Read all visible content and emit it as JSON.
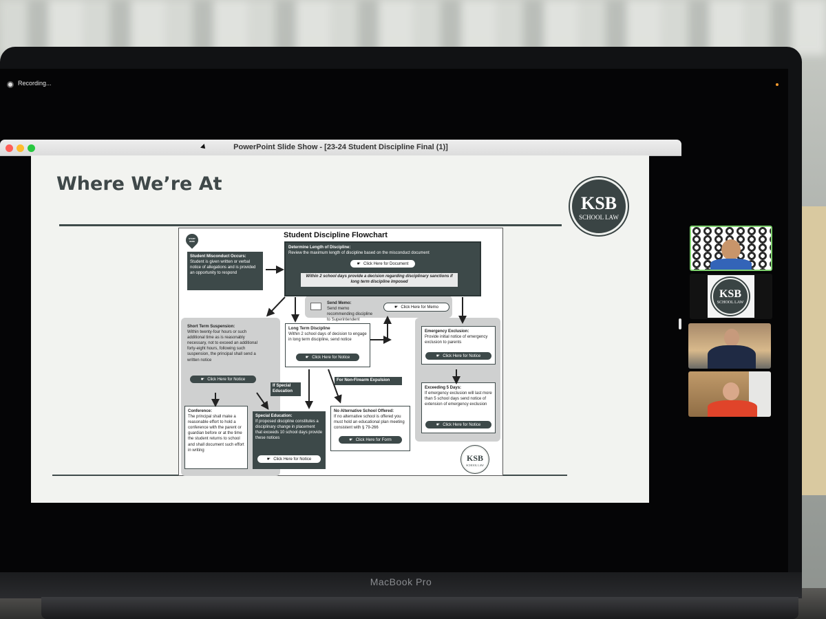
{
  "recording": {
    "label": "Recording..."
  },
  "window": {
    "title": "PowerPoint Slide Show - [23-24 Student Discipline Final (1)]"
  },
  "slide": {
    "title": "Where We’re At",
    "logo": {
      "main": "KSB",
      "sub": "SCHOOL LAW"
    }
  },
  "flowchart": {
    "title": "Student Discipline Flowchart",
    "start_label": "START HERE",
    "misconduct": {
      "head": "Student Misconduct Occurs:",
      "body": "Student is given written or verbal notice of allegations and is provided an opportunity to respond"
    },
    "length": {
      "head": "Determine Length of Discipline:",
      "body": "Review the maximum length of discipline based on the misconduct document",
      "button": "Click Here for Document",
      "note": "Within 2 school days provide a decision regarding disciplinary sanctions if long term discipline imposed"
    },
    "memo": {
      "head": "Send Memo:",
      "body": "Send memo recommending discipline to Superintendent",
      "button": "Click Here for Memo"
    },
    "short_term": {
      "head": "Short Term Suspension:",
      "body": "Within twenty-four hours or such additional time as is reasonably necessary, not to exceed an additional forty-eight hours, following such suspension, the principal shall send a written notice",
      "button": "Click Here for Notice"
    },
    "long_term": {
      "head": "Long Term Discipline",
      "body": "Within 2 school days of decision to engage in long term discipline, send notice",
      "button": "Click Here for Notice"
    },
    "emergency": {
      "head": "Emergency Exclusion:",
      "body": "Provide initial notice of emergency exclusion to parents",
      "button": "Click Here for Notice"
    },
    "exceeding": {
      "head": "Exceeding 5 Days:",
      "body": "If emergency exclusion will last more than 5 school days send notice of extension of emergency exclusion",
      "button": "Click Here for Notice"
    },
    "tag_special": "If Special Education",
    "tag_nonfirearm": "For Non-Firearm Expulsion",
    "conference": {
      "head": "Conference:",
      "body": "The principal shall make a reasonable effort to hold a conference with the parent or guardian before or at the time the student returns to school and shall document such effort in writing"
    },
    "special_ed": {
      "head": "Special Education:",
      "body": "If proposed discipline constitutes a disciplinary change in placement that exceeds 10 school days provide these notices",
      "button": "Click Here for Notice"
    },
    "no_alt": {
      "head": "No Alternative School Offered:",
      "body": "If no alternative school is offered you must hold an educational plan meeting consistent with § 79-266",
      "button": "Click Here for Form"
    },
    "logo": {
      "main": "KSB",
      "sub": "SCHOOL LAW"
    }
  },
  "participants": {
    "logo_tile": {
      "main": "KSB",
      "sub": "SCHOOL LAW"
    },
    "wall_logo": "KSB"
  },
  "laptop": {
    "model": "MacBook Pro"
  },
  "colors": {
    "slate": "#3d4949",
    "active_speaker": "#7fd36e",
    "red_shirt": "#e0442a"
  }
}
